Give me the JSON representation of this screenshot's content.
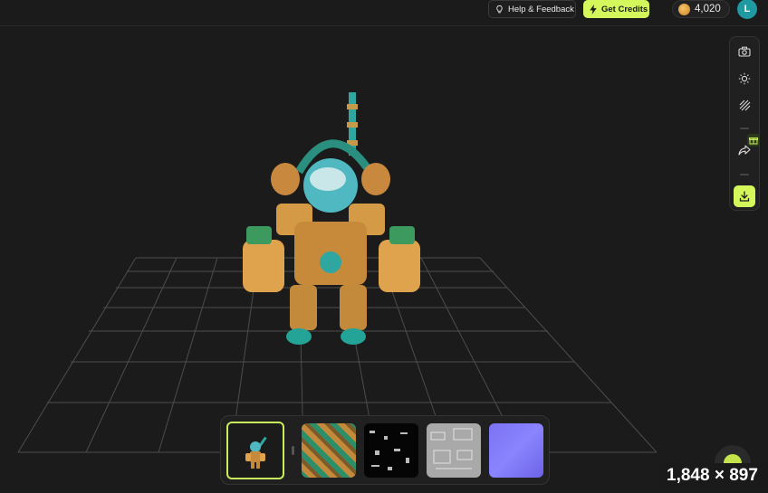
{
  "header": {
    "help_label": "Help & Feedback",
    "credits_button_label": "Get Credits",
    "credit_balance": "4,020",
    "avatar_initial": "L"
  },
  "toolbar": {
    "tools": [
      "camera-icon",
      "light-icon",
      "wireframe-icon",
      "share-icon",
      "download-icon"
    ]
  },
  "textures": {
    "items": [
      "model-preview",
      "base-color-map",
      "metallic-map",
      "roughness-map",
      "normal-map"
    ],
    "selected": "model-preview"
  },
  "overlay": {
    "dimensions": "1,848 × 897"
  },
  "colors": {
    "accent": "#d4f85c",
    "background": "#1b1b1b",
    "avatar": "#1e9aa0"
  }
}
